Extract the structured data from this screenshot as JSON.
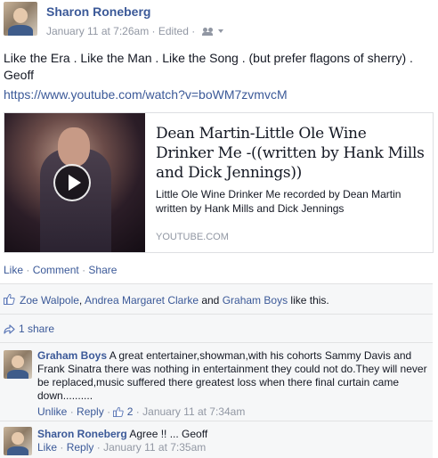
{
  "post": {
    "author": "Sharon Roneberg",
    "timestamp": "January 11 at 7:26am",
    "edited": "Edited",
    "audience_icon": "friends-icon",
    "body": "Like the Era . Like the Man . Like the Song . (but prefer flagons of sherry) . Geoff",
    "url": "https://www.youtube.com/watch?v=boWM7zvmvcM"
  },
  "preview": {
    "title": "Dean Martin-Little Ole Wine Drinker Me -((written by Hank Mills and Dick Jennings))",
    "description": "Little Ole Wine Drinker Me recorded by Dean Martin written by Hank Mills and Dick Jennings",
    "domain": "YOUTUBE.COM"
  },
  "actions": {
    "like": "Like",
    "comment": "Comment",
    "share": "Share",
    "sep": "·"
  },
  "likes": {
    "user1": "Zoe Walpole",
    "comma": ", ",
    "user2": "Andrea Margaret Clarke",
    "and": " and ",
    "user3": "Graham Boys",
    "suffix": " like this."
  },
  "shares": {
    "label": "1 share"
  },
  "comments": [
    {
      "author": "Graham Boys",
      "text": "A great entertainer,showman,with his cohorts Sammy Davis and Frank Sinatra there was nothing in entertainment they could not do.They will never be replaced,music suffered there greatest loss when there final curtain came down..........",
      "unlike": "Unlike",
      "reply": "Reply",
      "like_count": "2",
      "timestamp": "January 11 at 7:34am"
    },
    {
      "author": "Sharon Roneberg",
      "text": "Agree !! ... Geoff",
      "like": "Like",
      "reply": "Reply",
      "timestamp": "January 11 at 7:35am"
    }
  ],
  "colors": {
    "link": "#3b5998",
    "meta": "#9197a3",
    "ufi_bg": "#f6f7f8"
  }
}
